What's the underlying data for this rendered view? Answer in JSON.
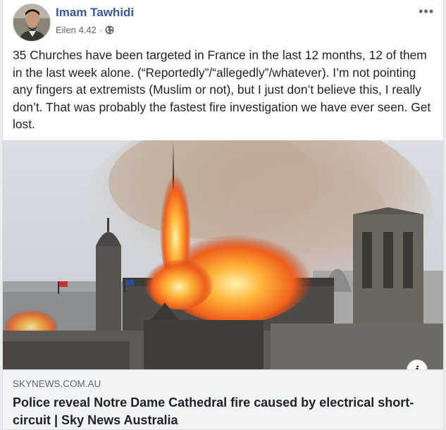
{
  "post": {
    "author": "Imam Tawhidi",
    "timestamp": "Eilen 4.42",
    "separator": "·",
    "privacy_icon": "globe-icon",
    "more_label": "•••",
    "text": "35 Churches have been targeted in France in the last 12 months, 12 of them in the last week alone. (“Reportedly”/“allegedly”/whatever). I’m not pointing any fingers at extremists (Muslim or not), but I just don’t believe this, I really don’t. That was probably the fastest fire investigation we have ever seen. Get lost."
  },
  "link": {
    "domain": "SKYNEWS.COM.AU",
    "title": "Police reveal Notre Dame Cathedral fire caused by electrical short-circuit | Sky News Australia",
    "info_label": "i"
  },
  "colors": {
    "author": "#365899",
    "text": "#1d2129",
    "meta": "#616770",
    "link_bg": "#f2f3f5"
  }
}
